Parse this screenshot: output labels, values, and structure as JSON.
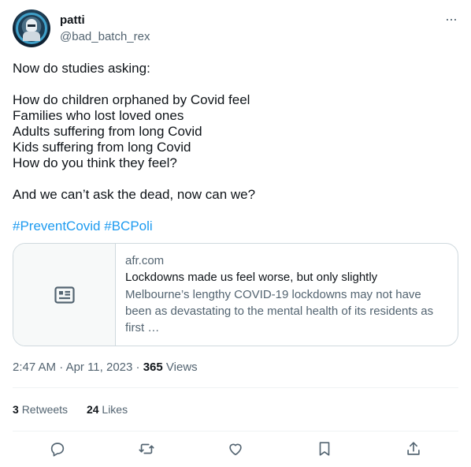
{
  "author": {
    "name": "patti",
    "handle": "@bad_batch_rex",
    "avatar_icon": "avatar-trooper-icon"
  },
  "tweet": {
    "lines": [
      "Now do studies asking:",
      "",
      "How do children orphaned by Covid feel",
      "Families who lost loved ones",
      "Adults suffering from long Covid",
      "Kids suffering from long Covid",
      "How do you think they feel?",
      "",
      "And we can’t ask the dead, now can we?"
    ],
    "hashtags": [
      "#PreventCovid",
      "#BCPoli"
    ]
  },
  "card": {
    "domain": "afr.com",
    "title": "Lockdowns made us feel worse, but only slightly",
    "description": "Melbourne’s lengthy COVID-19 lockdowns may not have been as devastating to the mental health of its residents as first …",
    "icon": "article-icon"
  },
  "meta": {
    "time": "2:47 AM",
    "separator": "·",
    "date": "Apr 11, 2023",
    "views_count": "365",
    "views_label": "Views"
  },
  "stats": {
    "retweets_count": "3",
    "retweets_label": "Retweets",
    "likes_count": "24",
    "likes_label": "Likes"
  },
  "actions": [
    "reply-icon",
    "retweet-icon",
    "like-icon",
    "bookmark-icon",
    "share-icon"
  ],
  "colors": {
    "link": "#1d9bf0",
    "secondary_text": "#536471",
    "primary_text": "#0f1419",
    "border": "#cfd9de"
  }
}
